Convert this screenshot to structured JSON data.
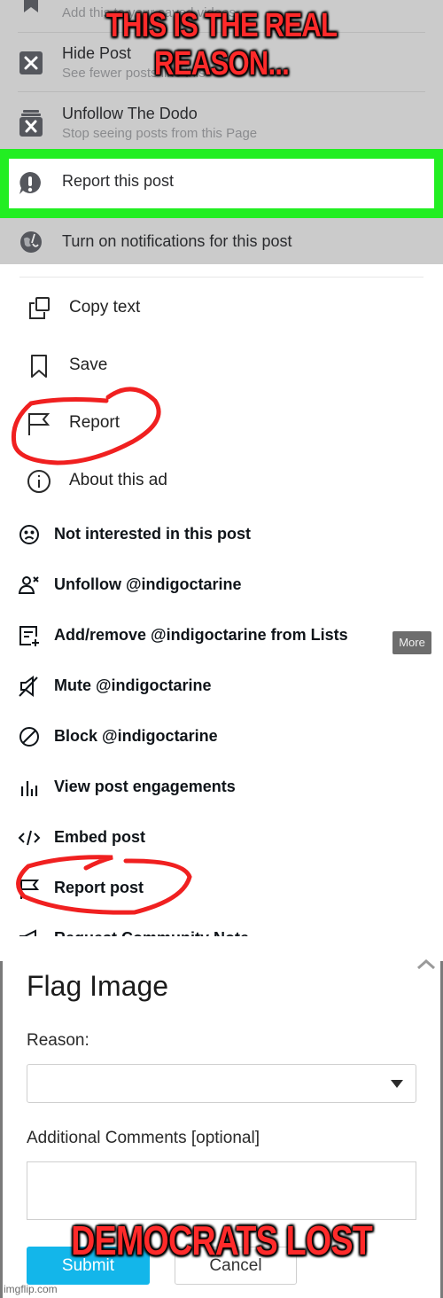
{
  "meme": {
    "top_caption": "THIS IS THE REAL REASON...",
    "bottom_caption": "DEMOCRATS LOST",
    "watermark": "imgflip.com"
  },
  "facebook_menu": {
    "items": [
      {
        "icon": "bookmark-icon",
        "title": "",
        "subtitle": "Add this to your saved videos"
      },
      {
        "icon": "hide-x-icon",
        "title": "Hide Post",
        "subtitle": "See fewer posts like this"
      },
      {
        "icon": "unfollow-stack-x-icon",
        "title": "Unfollow The Dodo",
        "subtitle": "Stop seeing posts from this Page"
      },
      {
        "icon": "report-exclamation-bubble-icon",
        "title": "Report this post",
        "subtitle": "",
        "highlighted": true
      },
      {
        "icon": "globe-notification-icon",
        "title": "Turn on notifications for this post",
        "subtitle": ""
      }
    ],
    "highlight_color": "#22ee22"
  },
  "threads_menu": {
    "items": [
      {
        "icon": "copy-icon",
        "label": "Copy text"
      },
      {
        "icon": "bookmark-icon",
        "label": "Save"
      },
      {
        "icon": "flag-icon",
        "label": "Report",
        "circled": true
      },
      {
        "icon": "info-icon",
        "label": "About this ad"
      }
    ]
  },
  "x_menu": {
    "items": [
      {
        "icon": "sad-face-icon",
        "label": "Not interested in this post"
      },
      {
        "icon": "unfollow-user-icon",
        "label": "Unfollow @indigoctarine"
      },
      {
        "icon": "list-add-icon",
        "label": "Add/remove @indigoctarine from Lists"
      },
      {
        "icon": "mute-icon",
        "label": "Mute @indigoctarine"
      },
      {
        "icon": "block-icon",
        "label": "Block @indigoctarine"
      },
      {
        "icon": "engagements-icon",
        "label": "View post engagements"
      },
      {
        "icon": "embed-code-icon",
        "label": "Embed post"
      },
      {
        "icon": "flag-icon",
        "label": "Report post",
        "circled": true
      },
      {
        "icon": "megaphone-icon",
        "label": "Request Community Note"
      }
    ],
    "more_tooltip": "More"
  },
  "flag_form": {
    "title": "Flag Image",
    "reason_label": "Reason:",
    "reason_value": "",
    "comments_label": "Additional Comments [optional]",
    "comments_value": "",
    "submit_label": "Submit",
    "cancel_label": "Cancel",
    "submit_color": "#13b6ea"
  },
  "annotation_color": "#f02020"
}
